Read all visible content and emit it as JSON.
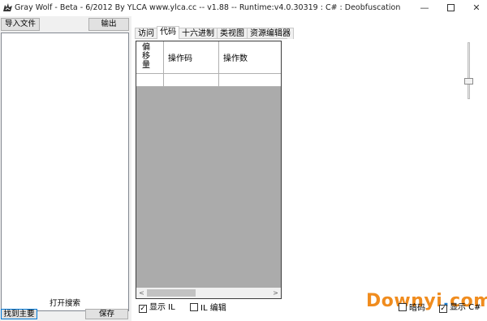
{
  "window": {
    "title": "Gray Wolf - Beta - 6/2012  By YLCA  www.ylca.cc -- v1.88 -- Runtime:v4.0.30319 : C# : Deobfuscation",
    "minimize_glyph": "—",
    "close_glyph": "✕"
  },
  "left_panel": {
    "import_label": "导入文件",
    "output_label": "输出",
    "search_label": "打开搜索",
    "find_main_label": "找到主要",
    "save_label": "保存"
  },
  "tabs": [
    {
      "label": "访问",
      "active": false
    },
    {
      "label": "代码",
      "active": true
    },
    {
      "label": "十六进制",
      "active": false
    },
    {
      "label": "类视图",
      "active": false
    },
    {
      "label": "资源编辑器",
      "active": false
    }
  ],
  "grid": {
    "columns": [
      "偏移量",
      "操作码",
      "操作数"
    ],
    "rows": [
      [
        "",
        "",
        ""
      ]
    ],
    "scroll_left": "<",
    "scroll_right": ">"
  },
  "options": {
    "show_il": {
      "label": "显示 IL",
      "checked": true
    },
    "il_edit": {
      "label": "IL 编辑",
      "checked": false
    },
    "dark": {
      "label": "暗码",
      "checked": false
    },
    "show_csharp": {
      "label": "显示 C#",
      "checked": true
    }
  },
  "watermark": {
    "brand": "Downyi",
    "dot": ".",
    "tld": "com"
  },
  "colors": {
    "grid_empty_area": "#ababab",
    "watermark_orange": "#f08c1e",
    "watermark_blue": "#1a7fd4",
    "panel_bg": "#f0f0f0"
  }
}
